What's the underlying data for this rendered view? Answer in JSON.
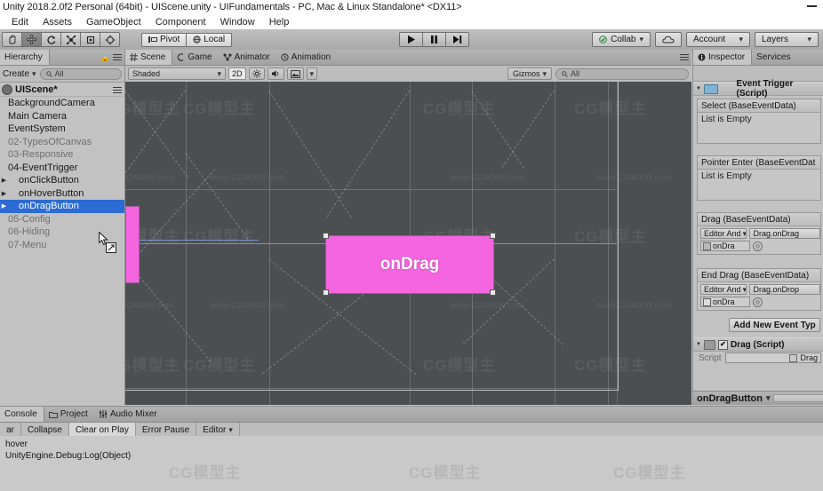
{
  "window": {
    "title": "Unity 2018.2.0f2 Personal (64bit) - UIScene.unity - UIFundamentals - PC, Mac & Linux Standalone* <DX11>",
    "minimize_label": "Minimize"
  },
  "menubar": {
    "items": [
      "Edit",
      "Assets",
      "GameObject",
      "Component",
      "Window",
      "Help"
    ]
  },
  "toolbar": {
    "tools": [
      {
        "name": "hand-tool",
        "glyph": "hand"
      },
      {
        "name": "move-tool",
        "glyph": "move"
      },
      {
        "name": "rotate-tool",
        "glyph": "rotate"
      },
      {
        "name": "scale-tool",
        "glyph": "scale"
      },
      {
        "name": "rect-tool",
        "glyph": "rect"
      },
      {
        "name": "transform-tool",
        "glyph": "transform"
      }
    ],
    "pivot_label": "Pivot",
    "local_label": "Local",
    "play_label": "Play",
    "pause_label": "Pause",
    "step_label": "Step",
    "collab_label": "Collab",
    "cloud_label": "Cloud Services",
    "account_label": "Account",
    "layers_label": "Layers"
  },
  "hierarchy": {
    "tab_label": "Hierarchy",
    "create_label": "Create",
    "search_placeholder": "All",
    "scene_name": "UIScene*",
    "items": [
      {
        "label": "BackgroundCamera",
        "indent": 1,
        "expandable": false,
        "dim": false,
        "selected": false
      },
      {
        "label": "Main Camera",
        "indent": 1,
        "expandable": false,
        "dim": false,
        "selected": false
      },
      {
        "label": "EventSystem",
        "indent": 1,
        "expandable": false,
        "dim": false,
        "selected": false
      },
      {
        "label": "02-TypesOfCanvas",
        "indent": 1,
        "expandable": false,
        "dim": true,
        "selected": false
      },
      {
        "label": "03-Responsive",
        "indent": 1,
        "expandable": false,
        "dim": true,
        "selected": false
      },
      {
        "label": "04-EventTrigger",
        "indent": 1,
        "expandable": false,
        "dim": false,
        "selected": false
      },
      {
        "label": "onClickButton",
        "indent": 2,
        "expandable": true,
        "dim": false,
        "selected": false
      },
      {
        "label": "onHoverButton",
        "indent": 2,
        "expandable": true,
        "dim": false,
        "selected": false
      },
      {
        "label": "onDragButton",
        "indent": 2,
        "expandable": true,
        "dim": false,
        "selected": true
      },
      {
        "label": "05-Config",
        "indent": 1,
        "expandable": false,
        "dim": true,
        "selected": false
      },
      {
        "label": "06-Hiding",
        "indent": 1,
        "expandable": false,
        "dim": true,
        "selected": false
      },
      {
        "label": "07-Menu",
        "indent": 1,
        "expandable": false,
        "dim": true,
        "selected": false
      }
    ]
  },
  "scene": {
    "tabs": [
      {
        "label": "Scene",
        "icon": "grid-icon",
        "selected": true
      },
      {
        "label": "Game",
        "icon": "gamepad-icon",
        "selected": false
      },
      {
        "label": "Animator",
        "icon": "animator-icon",
        "selected": false
      },
      {
        "label": "Animation",
        "icon": "clock-icon",
        "selected": false
      }
    ],
    "draw_mode": "Shaded",
    "twod_label": "2D",
    "lighting_icon": "sun-icon",
    "audio_icon": "speaker-icon",
    "fx_icon": "image-icon",
    "gizmos_label": "Gizmos",
    "gizmo_search_placeholder": "All",
    "selected_object_label": "onDrag",
    "watermark_brand": "CG模型主",
    "watermark_url": "www.CGMXW.com",
    "button_color": "#f565e0"
  },
  "inspector": {
    "tabs": [
      {
        "label": "Inspector",
        "selected": true
      },
      {
        "label": "Services",
        "selected": false
      }
    ],
    "event_trigger": {
      "header": "Event Trigger (Script)",
      "events": [
        {
          "title": "Select (BaseEventData)",
          "empty_text": "List is Empty",
          "has_entry": false
        },
        {
          "title": "Pointer Enter (BaseEventDat",
          "empty_text": "List is Empty",
          "has_entry": false
        },
        {
          "title": "Drag (BaseEventData)",
          "mode": "Editor And",
          "function": "Drag.onDrag",
          "object": "onDra",
          "has_entry": true
        },
        {
          "title": "End Drag (BaseEventData)",
          "mode": "Editor And",
          "function": "Drag.onDrop",
          "object": "onDra",
          "has_entry": true
        }
      ],
      "add_event_label": "Add New Event Typ"
    },
    "drag_script": {
      "header": "Drag (Script)",
      "enabled": true,
      "script_label": "Script",
      "script_value": "Drag"
    },
    "footer_label": "onDragButton"
  },
  "console": {
    "tabs": [
      {
        "label": "Console",
        "icon": "console-icon",
        "selected": true
      },
      {
        "label": "Project",
        "icon": "folder-icon",
        "selected": false
      },
      {
        "label": "Audio Mixer",
        "icon": "mixer-icon",
        "selected": false
      }
    ],
    "buttons": [
      {
        "label": "ar",
        "active": false
      },
      {
        "label": "Collapse",
        "active": false
      },
      {
        "label": "Clear on Play",
        "active": true
      },
      {
        "label": "Error Pause",
        "active": false
      },
      {
        "label": "Editor",
        "active": false,
        "caret": true
      }
    ],
    "log_entries": [
      {
        "message": "hover",
        "stack": "UnityEngine.Debug:Log(Object)"
      }
    ]
  }
}
